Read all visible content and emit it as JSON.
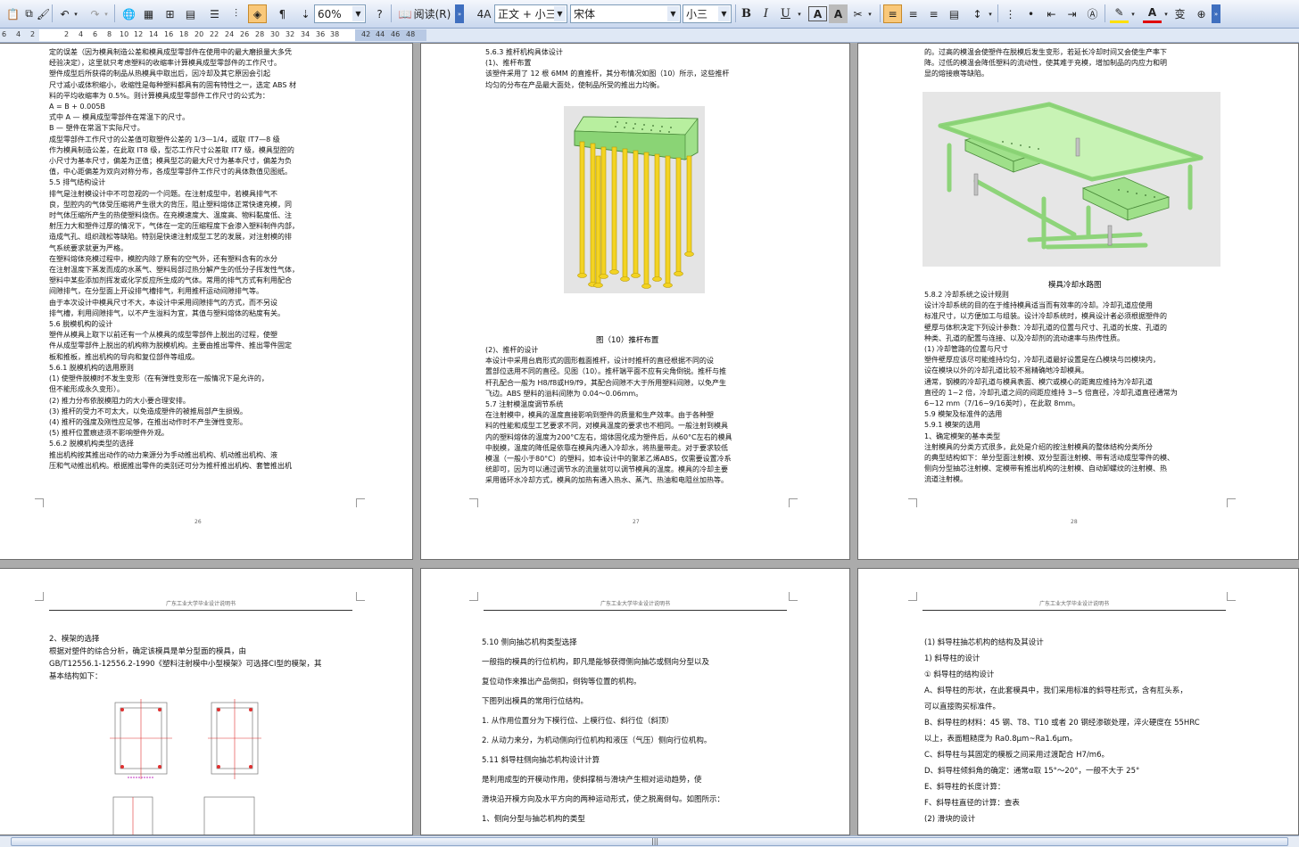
{
  "toolbar": {
    "zoom": "60%",
    "read_mode": "阅读(R)",
    "style": "正文 + 小三",
    "font": "宋体",
    "size": "小三",
    "bold": "B",
    "italic": "I",
    "underline": "U",
    "font_color_a": "A",
    "char_shade_a": "A"
  },
  "ruler": {
    "ticks": [
      "6",
      "4",
      "2",
      "2",
      "4",
      "6",
      "8",
      "10",
      "12",
      "14",
      "16",
      "18",
      "20",
      "22",
      "24",
      "26",
      "28",
      "30",
      "32",
      "34",
      "36",
      "38",
      "42",
      "44",
      "46",
      "48"
    ]
  },
  "pages": [
    {
      "number": "26",
      "lines": [
        "定的误差（因为模具制造公差和模具成型零部件在使用中的最大磨损量大多凭",
        "经验决定），这里就只考虑塑料的收缩率计算模具成型零部件的工作尺寸。",
        "    塑件成型后所获得的制品从热模具中取出后，因冷却及其它原因会引起",
        "尺寸减小或体积缩小，收缩性是每种塑料都具有的固有特性之一，选定 ABS 材",
        "料的平均收缩率为 0.5%。则计算模具成型零部件工作尺寸的公式为：",
        "                         A = B + 0.005B",
        "       式中               A — 模具成型零部件在常温下的尺寸。",
        "                          B — 塑件在常温下实际尺寸。",
        "    成型零部件工作尺寸的公差值可取塑件公差的 1/3—1/4，或取 IT7—8 级",
        "作为模具制造公差，在此取 IT8 级，型芯工作尺寸公差取 IT7 级，模具型腔的",
        "小尺寸为基本尺寸，偏差为正值；模具型芯的最大尺寸为基本尺寸，偏差为负",
        "值，中心距偏差为双向对称分布，各成型零部件工作尺寸的具体数值见图纸。",
        "5.5  排气结构设计",
        "    排气是注射模设计中不可忽视的一个问题。在注射成型中，若模具排气不",
        "良，型腔内的气体受压缩将产生很大的背压，阻止塑料熔体正常快速充模，同",
        "时气体压缩所产生的热使塑料烧伤。在充模速度大、温度高、物料黏度低、注",
        "射压力大和塑件过厚的情况下，气体在一定的压缩程度下会渗入塑料制件内部，",
        "造成气孔、组织疏松等缺陷。特别是快速注射成型工艺的发展，对注射模的排",
        "气系统要求就更为严格。",
        "    在塑料熔体充模过程中，模腔内除了原有的空气外，还有塑料含有的水分",
        "在注射温度下蒸发而成的水蒸气、塑料局部过热分解产生的低分子挥发性气体，",
        "塑料中某些添加剂挥发或化学反应所生成的气体。常用的排气方式有利用配合",
        "间隙排气，在分型面上开设排气槽排气，利用推杆运动间隙排气等。",
        "    由于本次设计中模具尺寸不大，本设计中采用间隙排气的方式，而不另设",
        "排气槽，利用间隙排气，以不产生溢料为宜，其值与塑料熔体的粘度有关。",
        "5.6  脱模机构的设计",
        "    塑件从模具上取下以前还有一个从模具的成型零部件上脱出的过程，使塑",
        "件从成型零部件上脱出的机构称为脱模机构。主要由推出零件、推出零件固定",
        "板和推板，推出机构的导向和复位部件等组成。",
        "5.6.1  脱模机构的选用原则",
        "   (1)  使塑件脱模时不发生变形（在有弹性变形在一般情况下是允许的，",
        "        但不能形成永久变形）。",
        "   (2)  推力分布依脱模阻力的大小要合理安排。",
        "   (3)  推杆的受力不可太大，以免造成塑件的被推局部产生损毁。",
        "   (4)  推杆的强度及刚性应足够，在推出动作时不产生弹性变形。",
        "   (5)  推杆位置痕迹须不影响塑件外观。",
        "5.6.2  脱模机构类型的选择",
        "    推出机构按其推出动作的动力来源分为手动推出机构、机动推出机构、液",
        "压和气动推出机构。根据推出零件的类别还可分为推杆推出机构、套管推出机"
      ]
    },
    {
      "number": "27",
      "lines_top": [
        "5.6.3  推杆机构具体设计",
        "(1)、推杆布置",
        "    该塑件采用了 12 根 6MM 的直推杆，其分布情况如图（10）所示，这些推杆",
        "均匀的分布在产品最大面处，使制品所受的推出力均衡。"
      ],
      "figure_caption": "图（10）推杆布置",
      "lines_bottom": [
        "(2)、推杆的设计",
        "    本设计中采用台肩形式的圆形截面推杆，设计时推杆的直径根据不同的设",
        "置部位选用不同的直径。见图（10）。推杆端平面不应有尖角倒锐。推杆与推",
        "杆孔配合一般为 H8/f8或H9/f9，其配合间隙不大于所用塑料间隙，以免产生",
        "飞边。ABS 塑料的溢料间隙为 0.04～0.06mm。",
        "5.7  注射模温度调节系统",
        "    在注射模中，模具的温度直接影响到塑件的质量和生产效率。由于各种塑",
        "料的性能和成型工艺要求不同，对模具温度的要求也不相同。一般注射到模具",
        "内的塑料熔体的温度为200°C左右，熔体固化成为塑件后，从60°C左右的模具",
        "中脱模，温度的降低是依靠在模具内通入冷却水，将热量带走。对于要求较低",
        "模温（一般小于80°C）的塑料，如本设计中的聚苯乙烯ABS，仅需要设置冷系",
        "统即可，因为可以通过调节水的流量就可以调节模具的温度。模具的冷却主要",
        "采用循环水冷却方式，模具的加热有通入热水、蒸汽、热油和电阻丝加热等。"
      ]
    },
    {
      "number": "28",
      "lines_top": [
        "的。过高的模温会使塑件在脱模后发生变形，若延长冷却时间又会使生产率下",
        "降。过低的模温会降低塑料的流动性，使其难于充模，增加制品的内应力和明",
        "显的熔接痕等缺陷。"
      ],
      "figure_caption": "模具冷却水路图",
      "lines_bottom": [
        "5.8.2  冷却系统之设计规则",
        "    设计冷却系统的目的在于维持模具适当而有效率的冷却。冷却孔道应使用",
        "标准尺寸，以方便加工与组装。设计冷却系统时，模具设计者必须根据塑件的",
        "壁厚与体积决定下列设计参数：冷却孔道的位置与尺寸、孔道的长度、孔道的",
        "种类、孔道的配置与连接、以及冷却剂的流动速率与热传性质。",
        "(1) 冷却管路的位置与尺寸",
        "    塑件壁厚应该尽可能维持均匀，冷却孔道最好设置是在凸模块与凹模块内，",
        "设在模块以外的冷却孔道比较不易精确地冷却模具。",
        "    通常，钢模的冷却孔道与模具表面、模穴或模心的距离应维持为冷却孔道",
        "直径的 1~2 倍，冷却孔道之间的间距应维持 3~5 倍直径，冷却孔道直径通常为",
        "6~12 mm（7/16~9/16英吋），在此取 8mm。",
        "5.9  模架及标准件的选用",
        "5.9.1  模架的选用",
        "1、确定模架的基本类型",
        "    注射模具的分类方式很多，此处是介绍的按注射模具的整体结构分类所分",
        "的典型结构如下：单分型面注射模、双分型面注射模、带有活动成型零件的模、",
        "侧向分型抽芯注射模、定模带有推出机构的注射模、自动卸螺纹的注射模、热",
        "流道注射模。"
      ]
    },
    {
      "header": "广东工业大学毕业设计说明书",
      "lines": [
        "2、模架的选择",
        "    根据对塑件的综合分析，确定该模具是单分型面的模具，由",
        "GB/T12556.1-12556.2-1990《塑料注射模中小型模架》可选择CI型的模架，其",
        "基本结构如下："
      ]
    },
    {
      "header": "广东工业大学毕业设计说明书",
      "lines": [
        "5.10 侧向抽芯机构类型选择",
        "    一般指的模具的行位机构，即凡是能够获得侧向抽芯或侧向分型以及",
        "复位动作来推出产品倒扣，倒钩等位置的机构。",
        "    下图列出模具的常用行位结构。",
        "    1. 从作用位置分为下模行位、上模行位、斜行位（斜顶）",
        "      2. 从动力来分，为机动侧向行位机构和液压（气压）侧向行位机构。",
        "5.11  斜导柱侧向抽芯机构设计计算",
        "        是利用成型的开模动作用，使斜撑梢与滑块产生相对运动趋势，使",
        "滑块沿开模方向及水平方向的两种运动形式，使之脱离倒勾。如图所示：",
        "    1、侧向分型与抽芯机构的类型"
      ]
    },
    {
      "header": "广东工业大学毕业设计说明书",
      "lines": [
        "(1) 斜导柱抽芯机构的结构及其设计",
        "1) 斜导柱的设计",
        "① 斜导柱的结构设计",
        "A、斜导柱的形状，在此套模具中，我们采用标准的斜导柱形式，含有肛头系，",
        "    可以直接购买标准件。",
        "B、斜导柱的材料：45 钢、T8、T10 或者 20 钢经渗碳处理，淬火硬度在 55HRC",
        "以上，表面粗糙度为 Ra0.8μm~Ra1.6μm。",
        "C、斜导柱与其固定的模板之间采用过渡配合 H7/m6。",
        "D、斜导柱倾斜角的确定：通常α取 15°～20°，一般不大于 25°",
        "E、斜导柱的长度计算：",
        "F、斜导柱直径的计算：查表",
        "(2) 滑块的设计"
      ]
    }
  ]
}
